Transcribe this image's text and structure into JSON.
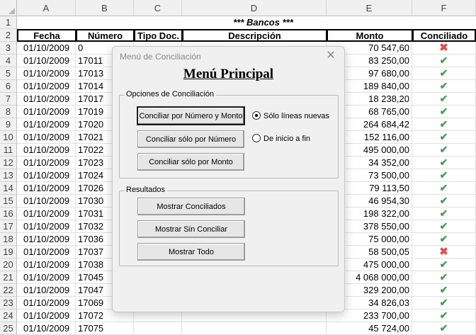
{
  "columns": [
    "A",
    "B",
    "C",
    "D",
    "E",
    "F"
  ],
  "banner": "*** Bancos ***",
  "headers": [
    "Fecha",
    "Número",
    "Tipo Doc.",
    "Descripción",
    "Monto",
    "Conciliado"
  ],
  "rows": [
    {
      "n": "3",
      "fecha": "01/10/2009",
      "num": "0",
      "monto": "70 547,60",
      "ok": false
    },
    {
      "n": "4",
      "fecha": "01/10/2009",
      "num": "17011",
      "monto": "83 250,00",
      "ok": true
    },
    {
      "n": "5",
      "fecha": "01/10/2009",
      "num": "17013",
      "monto": "97 680,00",
      "ok": true
    },
    {
      "n": "6",
      "fecha": "01/10/2009",
      "num": "17014",
      "monto": "189 840,00",
      "ok": true
    },
    {
      "n": "7",
      "fecha": "01/10/2009",
      "num": "17017",
      "monto": "18 238,20",
      "ok": true
    },
    {
      "n": "8",
      "fecha": "01/10/2009",
      "num": "17019",
      "monto": "68 765,00",
      "ok": true
    },
    {
      "n": "9",
      "fecha": "01/10/2009",
      "num": "17020",
      "monto": "264 684,42",
      "ok": true
    },
    {
      "n": "10",
      "fecha": "01/10/2009",
      "num": "17021",
      "monto": "152 116,00",
      "ok": true
    },
    {
      "n": "11",
      "fecha": "01/10/2009",
      "num": "17022",
      "monto": "495 000,00",
      "ok": true
    },
    {
      "n": "12",
      "fecha": "01/10/2009",
      "num": "17023",
      "monto": "34 352,00",
      "ok": true
    },
    {
      "n": "13",
      "fecha": "01/10/2009",
      "num": "17024",
      "monto": "73 500,00",
      "ok": true
    },
    {
      "n": "14",
      "fecha": "01/10/2009",
      "num": "17026",
      "monto": "79 113,50",
      "ok": true
    },
    {
      "n": "15",
      "fecha": "01/10/2009",
      "num": "17030",
      "monto": "46 954,30",
      "ok": true
    },
    {
      "n": "16",
      "fecha": "01/10/2009",
      "num": "17031",
      "monto": "198 322,00",
      "ok": true
    },
    {
      "n": "17",
      "fecha": "01/10/2009",
      "num": "17032",
      "monto": "378 550,00",
      "ok": true
    },
    {
      "n": "18",
      "fecha": "01/10/2009",
      "num": "17036",
      "monto": "75 000,00",
      "ok": true
    },
    {
      "n": "19",
      "fecha": "01/10/2009",
      "num": "17037",
      "monto": "58 500,05",
      "ok": false
    },
    {
      "n": "20",
      "fecha": "01/10/2009",
      "num": "17038",
      "monto": "475 000,00",
      "ok": true
    },
    {
      "n": "21",
      "fecha": "01/10/2009",
      "num": "17045",
      "monto": "4 068 000,00",
      "ok": true
    },
    {
      "n": "22",
      "fecha": "01/10/2009",
      "num": "17047",
      "monto": "329 200,00",
      "ok": true
    },
    {
      "n": "23",
      "fecha": "01/10/2009",
      "num": "17069",
      "monto": "34 826,03",
      "ok": true
    },
    {
      "n": "24",
      "fecha": "01/10/2009",
      "num": "17072",
      "monto": "233 700,00",
      "ok": true
    },
    {
      "n": "25",
      "fecha": "01/10/2009",
      "num": "17075",
      "monto": "45 724,00",
      "ok": true
    }
  ],
  "dialog": {
    "title": "Menú de Conciliación",
    "heading": "Menú Principal",
    "group1": "Opciones de Conciliación",
    "btn1": "Conciliar por Número y Monto",
    "btn2": "Conciliar sólo por Número",
    "btn3": "Conciliar sólo por Monto",
    "radio1": "Sólo líneas nuevas",
    "radio2": "De inicio a fin",
    "group2": "Resultados",
    "btn4": "Mostrar Conciliados",
    "btn5": "Mostrar Sin Conciliar",
    "btn6": "Mostrar Todo"
  },
  "colors": {
    "ok": "#4a9b59",
    "bad": "#d9534f"
  },
  "icons": {
    "ok": "check-icon",
    "bad": "cross-icon",
    "close": "close-icon"
  }
}
